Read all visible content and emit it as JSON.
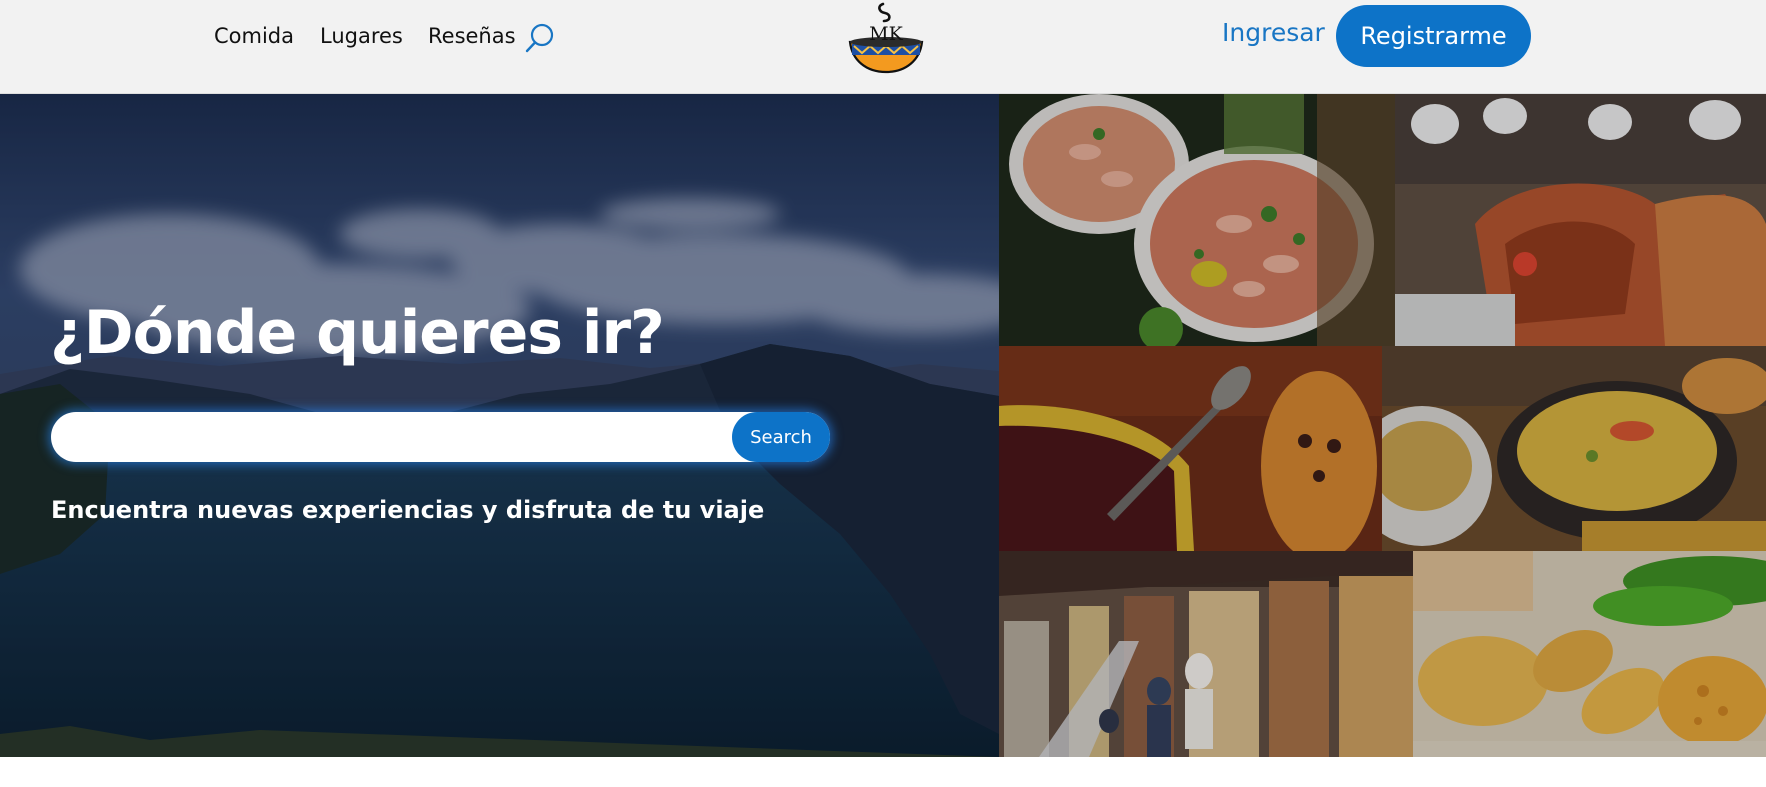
{
  "nav": {
    "items": [
      {
        "label": "Comida"
      },
      {
        "label": "Lugares"
      },
      {
        "label": "Reseñas"
      }
    ],
    "search_icon": "search-icon"
  },
  "logo": {
    "text": "MK",
    "icon": "soup-bowl-logo"
  },
  "auth": {
    "login_label": "Ingresar",
    "register_label": "Registrarme"
  },
  "hero": {
    "title": "¿Dónde quieres ir?",
    "search": {
      "placeholder": "",
      "value": "",
      "button_label": "Search"
    },
    "subtitle": "Encuentra nuevas experiencias y disfruta de tu viaje"
  },
  "gallery": {
    "images": [
      {
        "description": "shrimp-ceviche-photo"
      },
      {
        "description": "roast-pork-market-photo"
      },
      {
        "description": "colada-morada-guagua-bread-photo"
      },
      {
        "description": "locro-soup-photo"
      },
      {
        "description": "market-street-photo"
      },
      {
        "description": "fried-plantain-empanadas-photo"
      }
    ]
  },
  "colors": {
    "brand_blue": "#0d73c8",
    "link_blue": "#1976c4",
    "topbar_bg": "#f2f2f2"
  }
}
